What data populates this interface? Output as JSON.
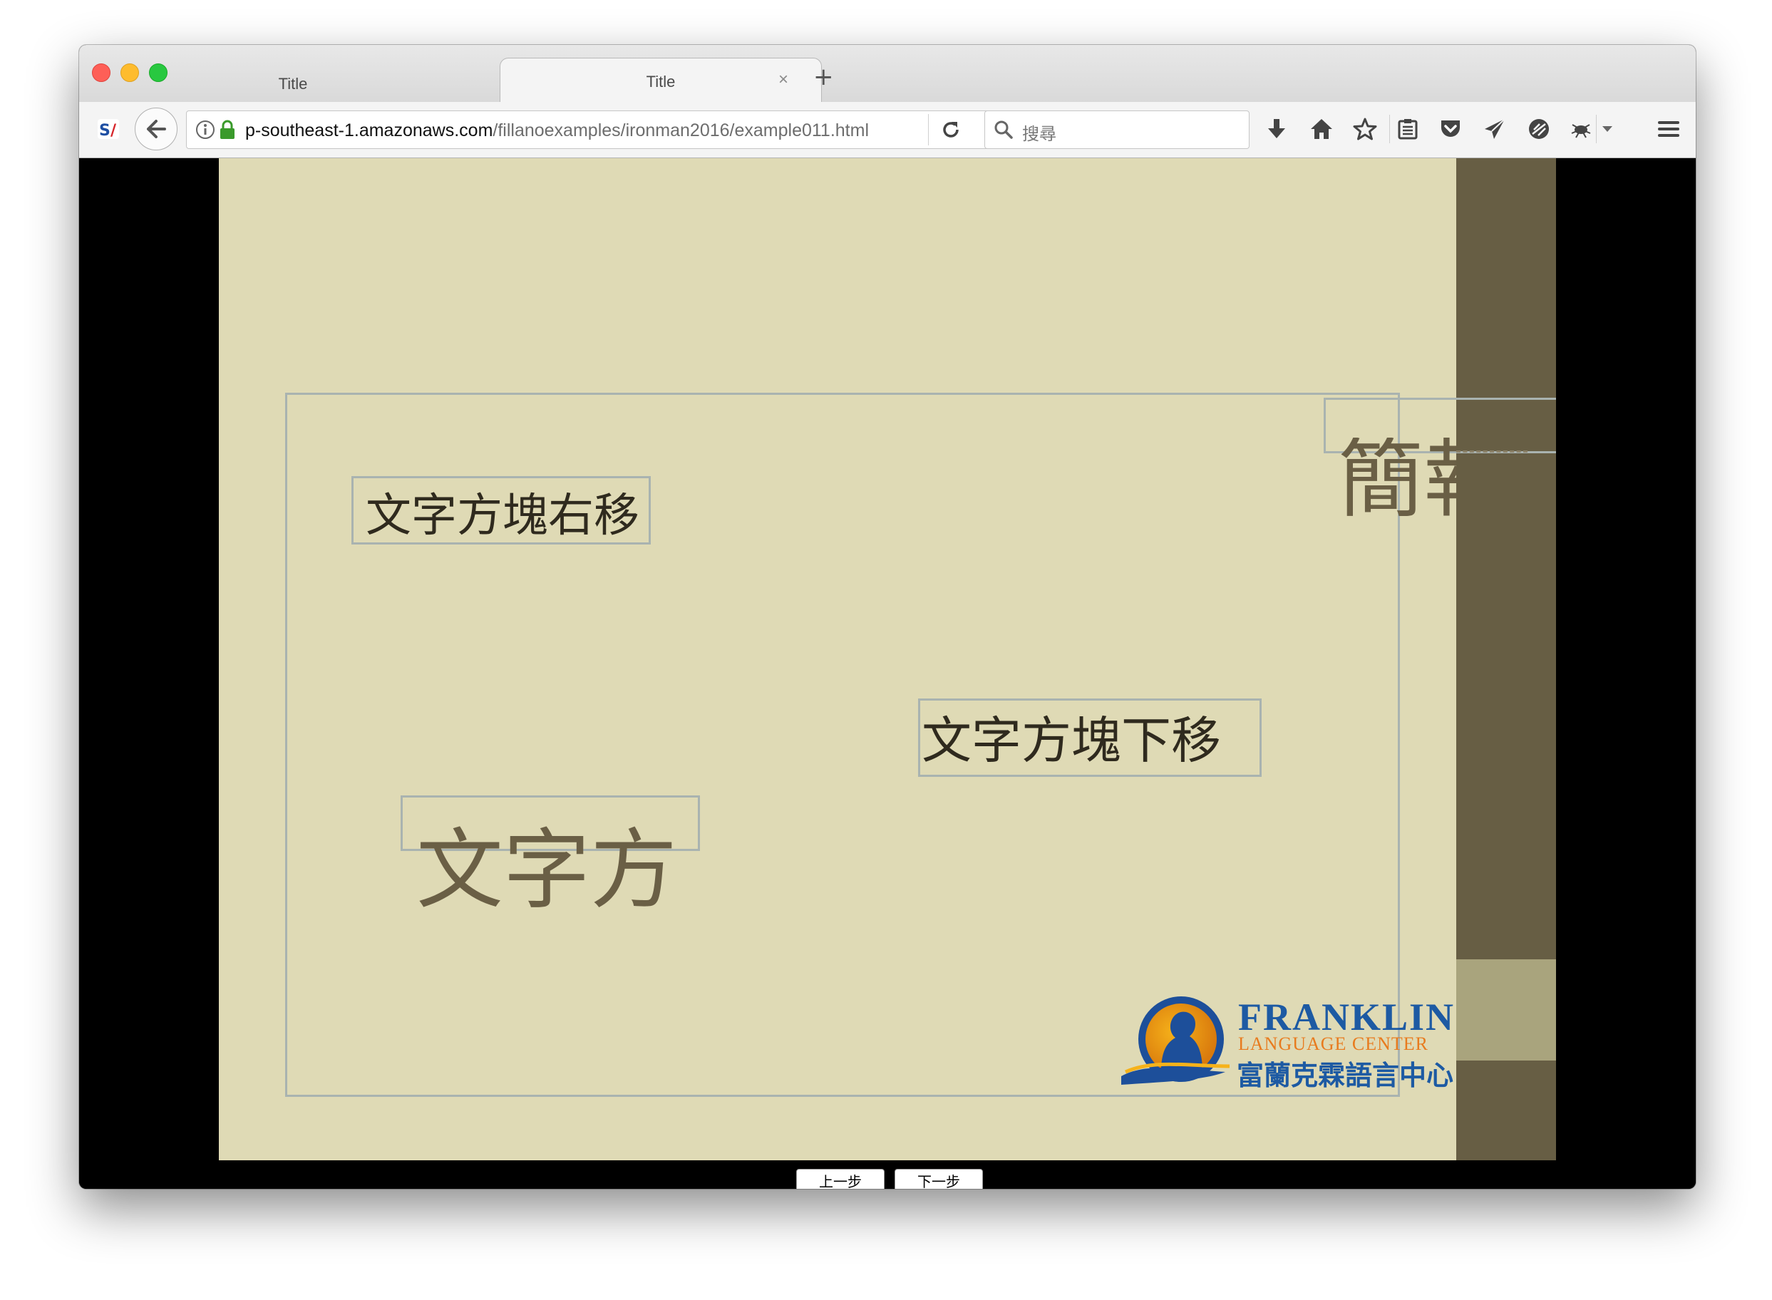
{
  "browser": {
    "tabs": [
      {
        "title": "Title",
        "close": "×"
      },
      {
        "title": "Title",
        "close": "×"
      }
    ],
    "new_tab": "+",
    "url": {
      "host": "p-southeast-1.amazonaws.com",
      "path": "/fillanoexamples/ironman2016/example011.html"
    },
    "search_placeholder": "搜尋",
    "toolbar_icons": [
      "extension-si-icon",
      "back-icon",
      "info-icon",
      "lock-icon",
      "reload-icon",
      "search-icon",
      "download-icon",
      "home-icon",
      "star-icon",
      "reading-list-icon",
      "pocket-icon",
      "send-icon",
      "privacy-icon",
      "bug-icon",
      "dropdown-icon",
      "menu-icon"
    ]
  },
  "page": {
    "text_right": "文字方塊右移",
    "text_down": "文字方塊下移",
    "text_big": "文字方",
    "text_intro": "簡報",
    "logo": {
      "name": "FRANKLIN",
      "sub": "LANGUAGE CENTER",
      "cn": "富蘭克霖語言中心"
    },
    "prev_button": "上一步",
    "next_button": "下一步",
    "colors": {
      "stage": "#dfdab5",
      "sidebar": "#675e44",
      "sidebar_light": "#a9a47d",
      "box_border": "#a9b3b0"
    }
  }
}
